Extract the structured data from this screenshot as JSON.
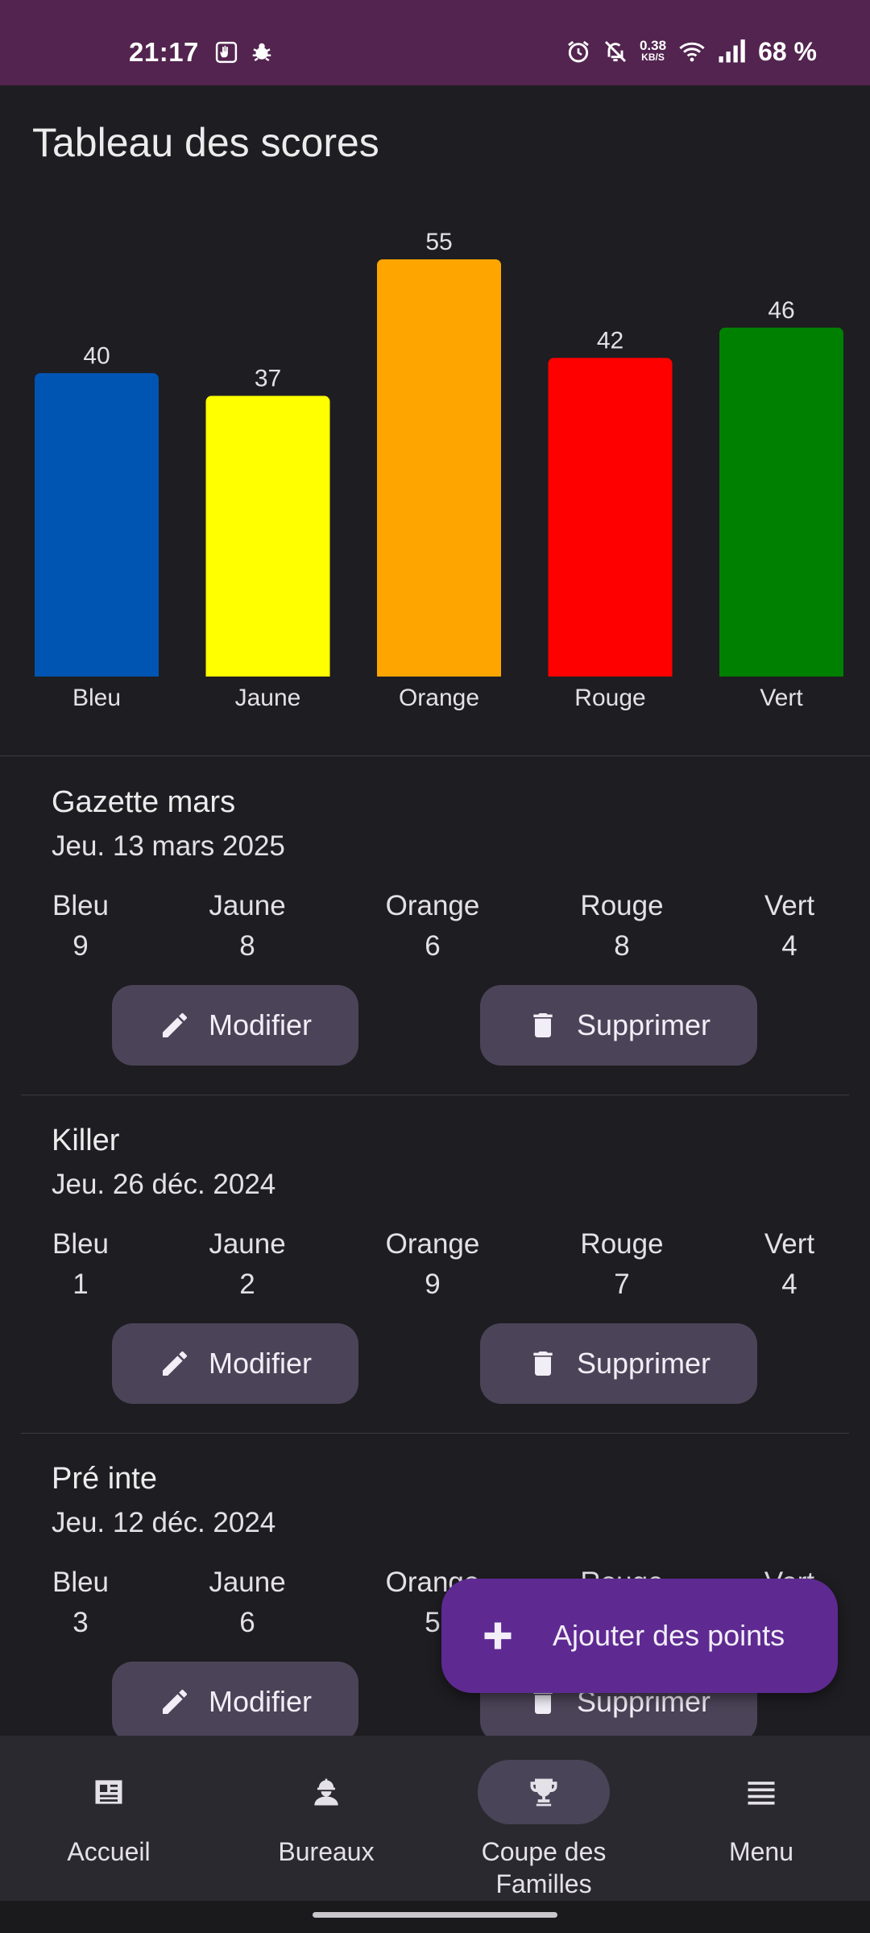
{
  "status_bar": {
    "time": "21:17",
    "net_speed_value": "0.38",
    "net_speed_unit": "KB/S",
    "battery": "68 %",
    "icons": [
      "hand-icon",
      "bug-icon",
      "alarm-icon",
      "bell-off-icon",
      "wifi-icon",
      "signal-icon"
    ]
  },
  "page": {
    "title": "Tableau des scores"
  },
  "chart_data": {
    "type": "bar",
    "categories": [
      "Bleu",
      "Jaune",
      "Orange",
      "Rouge",
      "Vert"
    ],
    "values": [
      40,
      37,
      55,
      42,
      46
    ],
    "colors": [
      "#0055b3",
      "#ffff00",
      "#ffa500",
      "#ff0000",
      "#008000"
    ],
    "title": "",
    "xlabel": "",
    "ylabel": "",
    "ylim": [
      0,
      55
    ],
    "grid": false,
    "data_labels": true
  },
  "entries": [
    {
      "title": "Gazette mars",
      "date": "Jeu. 13 mars 2025",
      "scores": [
        {
          "team": "Bleu",
          "value": "9"
        },
        {
          "team": "Jaune",
          "value": "8"
        },
        {
          "team": "Orange",
          "value": "6"
        },
        {
          "team": "Rouge",
          "value": "8"
        },
        {
          "team": "Vert",
          "value": "4"
        }
      ],
      "edit_label": "Modifier",
      "delete_label": "Supprimer"
    },
    {
      "title": "Killer",
      "date": "Jeu. 26 déc. 2024",
      "scores": [
        {
          "team": "Bleu",
          "value": "1"
        },
        {
          "team": "Jaune",
          "value": "2"
        },
        {
          "team": "Orange",
          "value": "9"
        },
        {
          "team": "Rouge",
          "value": "7"
        },
        {
          "team": "Vert",
          "value": "4"
        }
      ],
      "edit_label": "Modifier",
      "delete_label": "Supprimer"
    },
    {
      "title": "Pré inte",
      "date": "Jeu. 12 déc. 2024",
      "scores": [
        {
          "team": "Bleu",
          "value": "3"
        },
        {
          "team": "Jaune",
          "value": "6"
        },
        {
          "team": "Orange",
          "value": "5"
        },
        {
          "team": "Rouge",
          "value": ""
        },
        {
          "team": "Vert",
          "value": ""
        }
      ],
      "edit_label": "Modifier",
      "delete_label": "Supprimer"
    }
  ],
  "fab": {
    "label": "Ajouter des points",
    "icon": "plus-icon"
  },
  "bottom_nav": {
    "items": [
      {
        "label": "Accueil",
        "icon": "newspaper-icon"
      },
      {
        "label": "Bureaux",
        "icon": "worker-icon"
      },
      {
        "label": "Coupe des Familles",
        "icon": "trophy-icon",
        "active": true
      },
      {
        "label": "Menu",
        "icon": "menu-icon"
      }
    ]
  }
}
